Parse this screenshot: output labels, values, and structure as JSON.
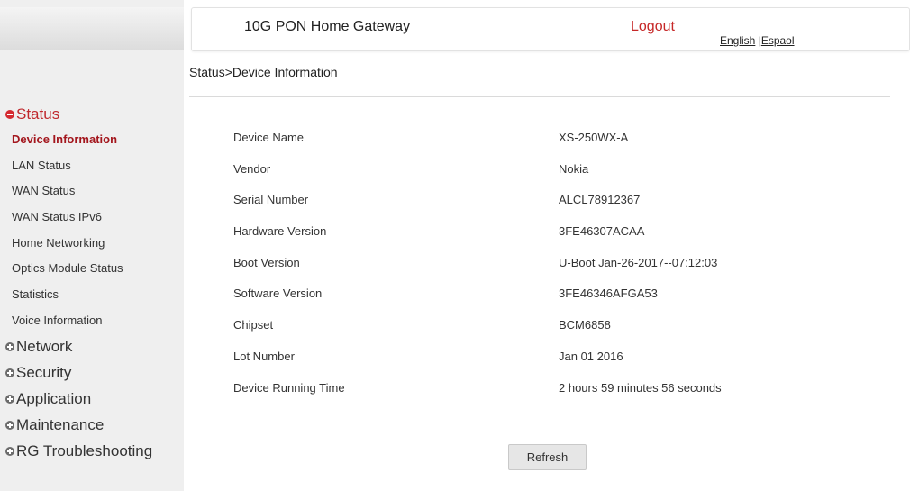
{
  "header": {
    "title": "10G PON Home Gateway",
    "logout_label": "Logout",
    "lang_english": "English",
    "lang_separator": " |",
    "lang_espanol": "Espaol"
  },
  "breadcrumb": "Status>Device Information",
  "sidebar": {
    "status_section": "Status",
    "status_items": [
      "Device Information",
      "LAN Status",
      "WAN Status",
      "WAN Status IPv6",
      "Home Networking",
      "Optics Module Status",
      "Statistics",
      "Voice Information"
    ],
    "sections": [
      "Network",
      "Security",
      "Application",
      "Maintenance",
      "RG Troubleshooting"
    ]
  },
  "device_info": [
    {
      "label": "Device Name",
      "value": "XS-250WX-A"
    },
    {
      "label": "Vendor",
      "value": "Nokia"
    },
    {
      "label": "Serial Number",
      "value": "ALCL78912367"
    },
    {
      "label": "Hardware Version",
      "value": "3FE46307ACAA"
    },
    {
      "label": "Boot Version",
      "value": "U-Boot Jan-26-2017--07:12:03"
    },
    {
      "label": "Software Version",
      "value": "3FE46346AFGA53"
    },
    {
      "label": "Chipset",
      "value": "BCM6858"
    },
    {
      "label": "Lot Number",
      "value": "Jan 01 2016"
    },
    {
      "label": "Device Running Time",
      "value": "2 hours 59 minutes 56 seconds"
    }
  ],
  "refresh_label": "Refresh",
  "colors": {
    "accent_red": "#c0282d",
    "selected_item": "#a3161d",
    "sidebar_bg": "#efefef"
  }
}
